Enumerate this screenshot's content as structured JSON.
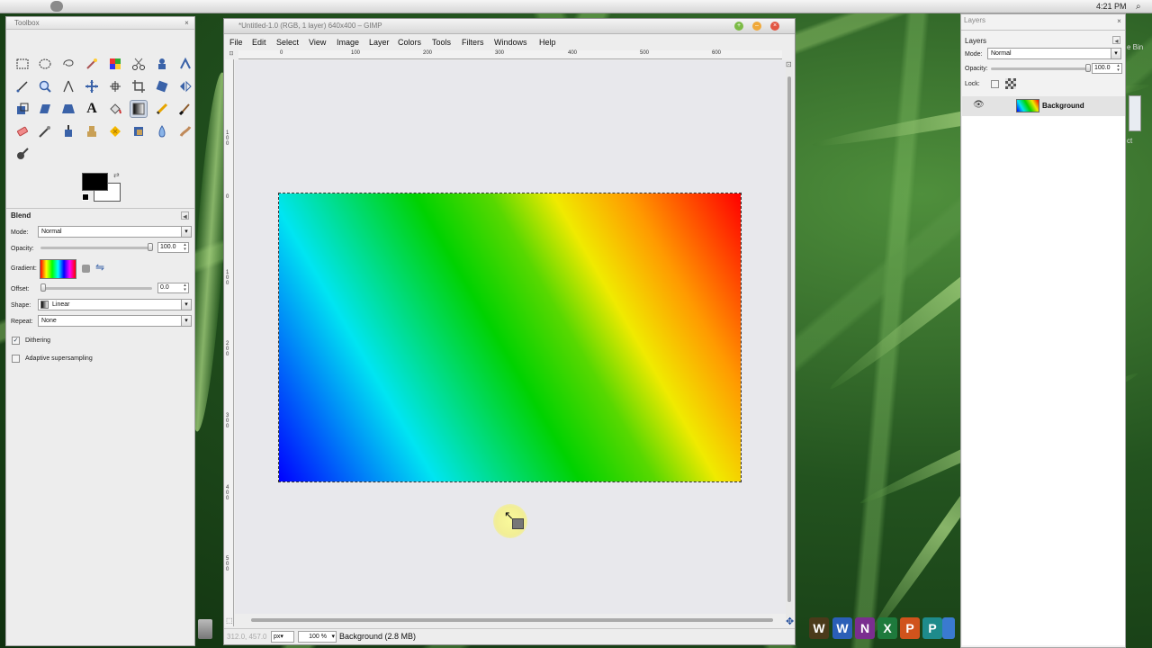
{
  "menubar": {
    "clock": "4:21 PM"
  },
  "toolbox": {
    "title": "Toolbox",
    "tool_options": {
      "title": "Blend",
      "mode_label": "Mode:",
      "mode_value": "Normal",
      "opacity_label": "Opacity:",
      "opacity_value": "100.0",
      "gradient_label": "Gradient:",
      "offset_label": "Offset:",
      "offset_value": "0.0",
      "shape_label": "Shape:",
      "shape_value": "Linear",
      "repeat_label": "Repeat:",
      "repeat_value": "None",
      "dithering_label": "Dithering",
      "dithering_checked": true,
      "adaptive_label": "Adaptive supersampling",
      "adaptive_checked": false
    }
  },
  "image_window": {
    "title": "*Untitled-1.0 (RGB, 1 layer) 640x400 – GIMP",
    "menu": [
      "File",
      "Edit",
      "Select",
      "View",
      "Image",
      "Layer",
      "Colors",
      "Tools",
      "Filters",
      "Windows",
      "Help"
    ],
    "ruler_top_labels": [
      "0",
      "100",
      "200",
      "300",
      "400",
      "500",
      "600"
    ],
    "ruler_left_labels": [
      "1\n0\n0",
      "0",
      "1\n0\n0",
      "2\n0\n0",
      "3\n0\n0",
      "4\n0\n0",
      "5\n0\n0"
    ],
    "status": {
      "coords": "312.0, 457.0",
      "unit": "px",
      "zoom": "100 %",
      "text": "Background (2.8 MB)"
    }
  },
  "layers": {
    "dock_title": "Layers",
    "tab_label": "Layers",
    "mode_label": "Mode:",
    "mode_value": "Normal",
    "opacity_label": "Opacity:",
    "opacity_value": "100.0",
    "lock_label": "Lock:",
    "items": [
      {
        "name": "Background",
        "visible": true
      }
    ]
  },
  "desktop": {
    "side_text_1": "e Bin",
    "side_text_2": "ct"
  }
}
